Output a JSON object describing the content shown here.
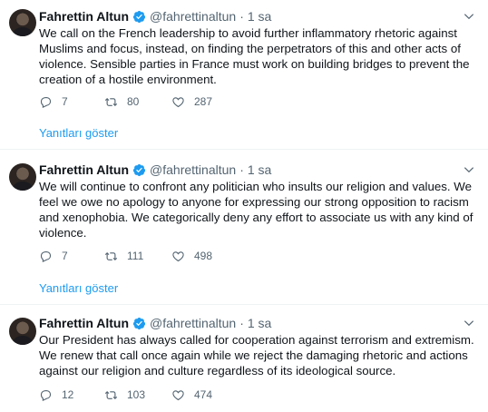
{
  "colors": {
    "accent": "#1d9bf0",
    "muted": "#536471",
    "text": "#0f1419"
  },
  "tweets": [
    {
      "name": "Fahrettin Altun",
      "handle": "@fahrettinaltun",
      "separator": "·",
      "time": "1 sa",
      "text": "We call on the French leadership to avoid further inflammatory rhetoric against Muslims and focus, instead, on finding the perpetrators of this and other acts of violence. Sensible parties in France must work on building bridges to prevent the creation of a hostile environment.",
      "replies": "7",
      "retweets": "80",
      "likes": "287",
      "show_replies": "Yanıtları göster"
    },
    {
      "name": "Fahrettin Altun",
      "handle": "@fahrettinaltun",
      "separator": "·",
      "time": "1 sa",
      "text": "We will continue to confront any politician who insults our religion and values. We feel we owe no apology to anyone for expressing our strong opposition to racism and xenophobia. We categorically deny any effort to associate us with any kind of violence.",
      "replies": "7",
      "retweets": "111",
      "likes": "498",
      "show_replies": "Yanıtları göster"
    },
    {
      "name": "Fahrettin Altun",
      "handle": "@fahrettinaltun",
      "separator": "·",
      "time": "1 sa",
      "text": "Our President has always called for cooperation against terrorism and extremism. We renew that call once again while we reject the damaging rhetoric and actions against our religion and culture regardless of its ideological source.",
      "replies": "12",
      "retweets": "103",
      "likes": "474"
    }
  ]
}
